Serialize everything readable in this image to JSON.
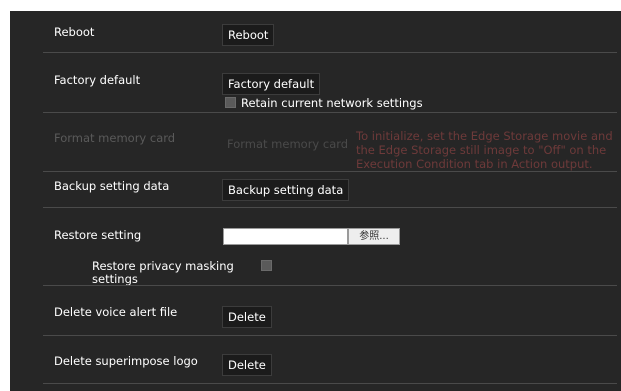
{
  "reboot": {
    "label": "Reboot",
    "button": "Reboot"
  },
  "factory_default": {
    "label": "Factory default",
    "button": "Factory default",
    "retain_checkbox_label": "Retain current network settings"
  },
  "format_memory_card": {
    "label": "Format memory card",
    "button": "Format memory card",
    "note_line1": "To initialize, set the Edge Storage movie and",
    "note_line2": "the Edge Storage still image to \"Off\" on the",
    "note_line3": "Execution Condition tab in Action output."
  },
  "backup": {
    "label": "Backup setting data",
    "button": "Backup setting data"
  },
  "restore": {
    "label": "Restore setting",
    "file_value": "",
    "browse_button": "参照...",
    "privacy_label_line1": "Restore privacy masking",
    "privacy_label_line2": "settings"
  },
  "delete_voice": {
    "label": "Delete voice alert file",
    "button": "Delete"
  },
  "delete_logo": {
    "label": "Delete superimpose logo",
    "button": "Delete"
  }
}
